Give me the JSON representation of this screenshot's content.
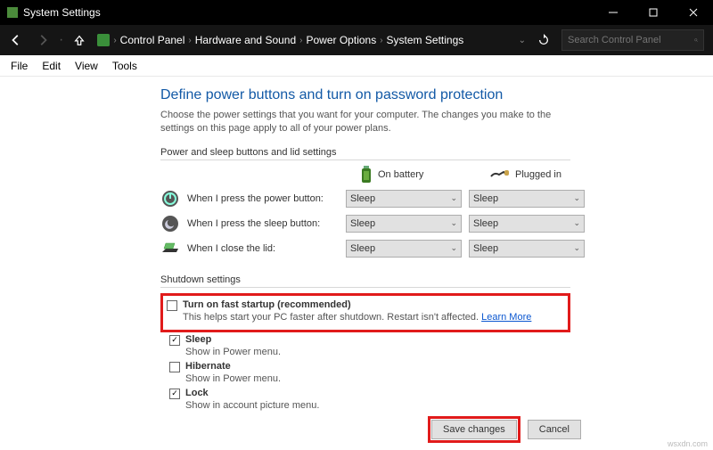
{
  "window": {
    "title": "System Settings",
    "breadcrumb": [
      "Control Panel",
      "Hardware and Sound",
      "Power Options",
      "System Settings"
    ],
    "search_placeholder": "Search Control Panel"
  },
  "menu": {
    "file": "File",
    "edit": "Edit",
    "view": "View",
    "tools": "Tools"
  },
  "page": {
    "heading": "Define power buttons and turn on password protection",
    "description": "Choose the power settings that you want for your computer. The changes you make to the settings on this page apply to all of your power plans.",
    "section1_label": "Power and sleep buttons and lid settings",
    "col_battery": "On battery",
    "col_plugged": "Plugged in",
    "rows": {
      "power_btn": "When I press the power button:",
      "sleep_btn": "When I press the sleep button:",
      "lid": "When I close the lid:"
    },
    "select_value": "Sleep",
    "shutdown_label": "Shutdown settings",
    "opts": {
      "fast_startup": {
        "title": "Turn on fast startup (recommended)",
        "sub": "This helps start your PC faster after shutdown. Restart isn't affected. ",
        "link": "Learn More",
        "checked": false
      },
      "sleep": {
        "title": "Sleep",
        "sub": "Show in Power menu.",
        "checked": true
      },
      "hibernate": {
        "title": "Hibernate",
        "sub": "Show in Power menu.",
        "checked": false
      },
      "lock": {
        "title": "Lock",
        "sub": "Show in account picture menu.",
        "checked": true
      }
    },
    "save_btn": "Save changes",
    "cancel_btn": "Cancel",
    "watermark": "wsxdn.com"
  }
}
